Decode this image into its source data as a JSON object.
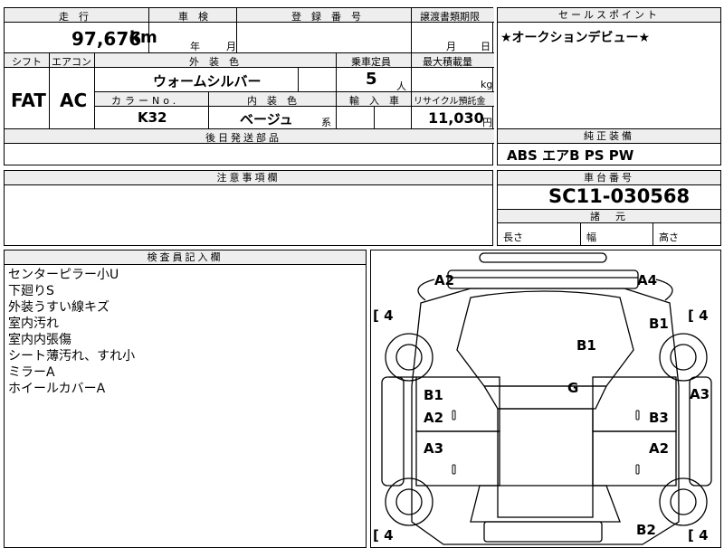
{
  "top": {
    "mileage_label": "走　行",
    "mileage_value": "97,676",
    "mileage_unit": "km",
    "shaken_label": "車　検",
    "shaken_year": "年",
    "shaken_month": "月",
    "reg_label": "登　録　番　号",
    "transfer_label": "譲渡書類期限",
    "transfer_month": "月",
    "transfer_day": "日",
    "shift_label": "シフト",
    "ac_label": "エアコン",
    "shift_value": "FAT",
    "ac_value": "AC",
    "exterior_label": "外　装　色",
    "exterior_value": "ウォームシルバー",
    "capacity_label": "乗車定員",
    "capacity_value": "5",
    "capacity_unit": "人",
    "maxload_label": "最大積載量",
    "maxload_unit": "kg",
    "color_no_label": "カラーNo.",
    "color_no_value": "K32",
    "interior_label": "内　装　色",
    "interior_value": "ベージュ",
    "interior_suffix": "系",
    "import_label": "輸　入　車",
    "recycle_label": "リサイクル預託金",
    "recycle_value": "11,030",
    "recycle_unit": "円",
    "later_parts_label": "後日発送部品"
  },
  "sales": {
    "header": "セールスポイント",
    "text": "★オークションデビュー★"
  },
  "equipment": {
    "header": "純正装備",
    "text": "ABS エアB PS PW"
  },
  "notes": {
    "header": "注意事項欄"
  },
  "chassis": {
    "header": "車台番号",
    "value": "SC11-030568"
  },
  "dims": {
    "header": "諸　元",
    "length": "長さ",
    "width": "幅",
    "height": "高さ"
  },
  "inspector": {
    "header": "検査員記入欄",
    "lines": [
      "センターピラー小U",
      "下廻りS",
      "外装うすい線キズ",
      "室内汚れ",
      "室内内張傷",
      "シート薄汚れ、すれ小",
      "ミラーA",
      "ホイールカバーA"
    ]
  },
  "diagram": {
    "tires": [
      "4",
      "4",
      "4",
      "4"
    ],
    "labels": {
      "front_left": "A2",
      "front_right": "A4",
      "right_front_fender": "B1",
      "hood": "B1",
      "windshield": "G",
      "right_side": "A3",
      "left_front_door": "B1",
      "left_front_door2": "A2",
      "right_front_door": "B3",
      "left_rear_door": "A3",
      "right_rear_door": "A2",
      "rear_right": "B2"
    }
  }
}
